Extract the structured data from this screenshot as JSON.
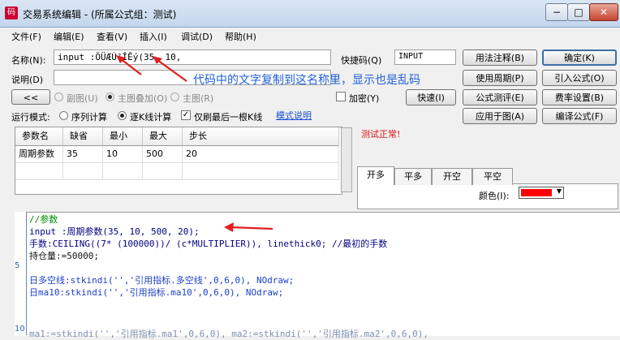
{
  "window": {
    "title": "交易系统编辑 - (所属公式组：测试)",
    "minimize_glyph": "−",
    "maximize_glyph": "□",
    "close_glyph": "✕"
  },
  "menu": [
    "文件(F)",
    "编辑(E)",
    "查看(V)",
    "插入(I)",
    "调试(D)",
    "帮助(H)"
  ],
  "form": {
    "name_label": "名称(N):",
    "name_value": "input :ÖÜÆÚ²ÎÊý(35,  10,",
    "shortcut_label": "快捷码(Q)",
    "shortcut_value": "INPUT",
    "desc_label": "说明(D)",
    "desc_value": "",
    "arrow_btn": "<<",
    "chart_modes": [
      "副图(U)",
      "主图叠加(O)",
      "主图(R)"
    ],
    "chart_mode_selected": "主图叠加(O)",
    "encrypt_label": "加密(Y)",
    "quick_btn": "快速(I)",
    "run_mode_label": "运行模式:",
    "run_modes": [
      "序列计算",
      "逐K线计算"
    ],
    "run_mode_selected": "逐K线计算",
    "only_last_label": "仅刷最后一根K线",
    "only_last_checked": true,
    "mode_help_link": "模式说明"
  },
  "buttons_right": {
    "usage_note": "用法注释(B)",
    "ok": "确定(K)",
    "use_period": "使用周期(P)",
    "cite_formula": "引入公式(O)",
    "formula_test": "公式测评(E)",
    "fee_settings": "费率设置(B)",
    "apply_chart": "应用于图(A)",
    "compile": "编译公式(F)"
  },
  "status_text": "测试正常!",
  "annotation": "代码中的文字复制到这名称里，显示也是乱码",
  "param_table": {
    "headers": [
      "参数名",
      "缺省",
      "最小",
      "最大",
      "步长"
    ],
    "rows": [
      [
        "周期参数",
        "35",
        "10",
        "500",
        "20"
      ]
    ]
  },
  "signal_tabs": [
    "开多",
    "平多",
    "开空",
    "平空"
  ],
  "signal_tab_selected": "开多",
  "color_label": "颜色(I):",
  "color_value": "#ff0000",
  "editor": {
    "line_numbers": [
      "5",
      "10"
    ],
    "lines": [
      "//参数",
      "input :周期参数(35, 10, 500, 20);",
      "手数:CEILING((7* (100000))/ (c*MULTIPLIER)), linethick0; //最初的手数",
      "持仓量:=50000;",
      "",
      "日多空线:stkindi('','引用指标.多空线',0,6,0), NOdraw;",
      "日ma10:stkindi('','引用指标.ma10',0,6,0), NOdraw;"
    ],
    "last_line_fragment": "ma1:=stkindi('','引用指标.ma1',0,6,0), ma2:=stkindi('','引用指标.ma2',0,6,0),"
  }
}
